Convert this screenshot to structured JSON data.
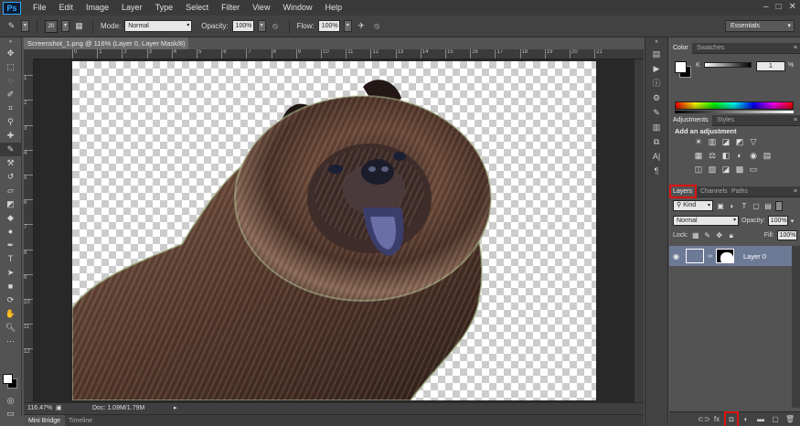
{
  "app": {
    "logo": "Ps"
  },
  "menu": [
    "File",
    "Edit",
    "Image",
    "Layer",
    "Type",
    "Select",
    "Filter",
    "View",
    "Window",
    "Help"
  ],
  "window_controls": [
    "–",
    "□",
    "✕"
  ],
  "options": {
    "brush_size": "20",
    "mode_label": "Mode:",
    "mode_value": "Normal",
    "opacity_label": "Opacity:",
    "opacity_value": "100%",
    "flow_label": "Flow:",
    "flow_value": "100%",
    "workspace": "Essentials"
  },
  "document": {
    "tab_title": "Screenshot_1.png @ 116% (Layer 0, Layer Mask/8) *",
    "close": "×",
    "ruler_marks": [
      "0",
      "1",
      "2",
      "3",
      "4",
      "5",
      "6",
      "7",
      "8",
      "9",
      "10",
      "11",
      "12",
      "13",
      "14",
      "15",
      "16",
      "17",
      "18",
      "19",
      "20",
      "21"
    ],
    "vruler_marks": [
      "1",
      "2",
      "3",
      "4",
      "5",
      "6",
      "7",
      "8",
      "9",
      "10",
      "11",
      "12"
    ],
    "zoom": "116.47%",
    "doc_info": "Doc: 1.09M/1.79M"
  },
  "bottom_tabs": {
    "mini_bridge": "Mini Bridge",
    "timeline": "Timeline"
  },
  "color_panel": {
    "tabs": [
      "Color",
      "Swatches"
    ],
    "channel_label": "K",
    "channel_value": "1",
    "unit": "%"
  },
  "adjustments_panel": {
    "tabs": [
      "Adjustments",
      "Styles"
    ],
    "heading": "Add an adjustment"
  },
  "layers_panel": {
    "tabs": [
      "Layers",
      "Channels",
      "Paths"
    ],
    "kind": "Kind",
    "blend_mode": "Normal",
    "opacity_label": "Opacity:",
    "opacity_value": "100%",
    "lock_label": "Lock:",
    "fill_label": "Fill:",
    "fill_value": "100%",
    "layer_name": "Layer 0"
  },
  "colors": {
    "accent_highlight": "#d11111",
    "selected_layer": "#6d7a96"
  }
}
